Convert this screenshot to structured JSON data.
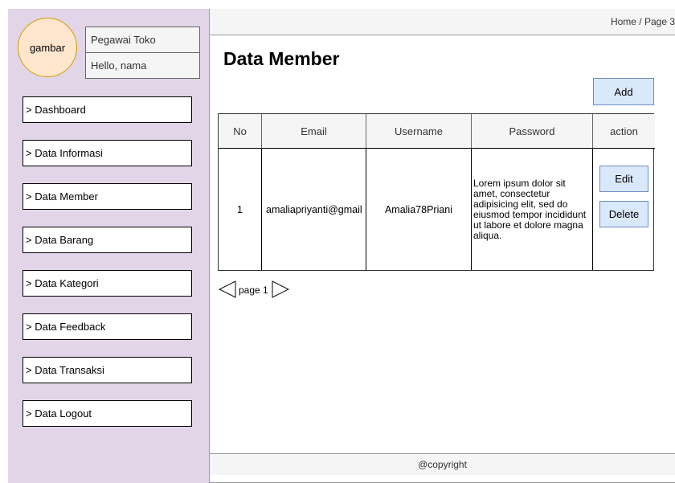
{
  "sidebar": {
    "avatar_text": "gambar",
    "role": "Pegawai Toko",
    "greeting": "Hello, nama",
    "items": [
      {
        "label": "> Dashboard"
      },
      {
        "label": "> Data Informasi"
      },
      {
        "label": "> Data Member"
      },
      {
        "label": "> Data Barang"
      },
      {
        "label": "> Data Kategori"
      },
      {
        "label": "> Data Feedback"
      },
      {
        "label": "> Data Transaksi"
      },
      {
        "label": "> Data Logout"
      }
    ]
  },
  "header": {
    "breadcrumb": "Home / Page 3"
  },
  "main": {
    "title": "Data Member",
    "add_label": "Add",
    "table": {
      "columns": [
        "No",
        "Email",
        "Username",
        "Password",
        "action"
      ],
      "rows": [
        {
          "no": "1",
          "email": "amaliapriyanti@gmail",
          "username": "Amalia78Priani",
          "password": "Lorem ipsum dolor sit amet, consectetur adipisicing elit, sed do eiusmod tempor incididunt ut labore et dolore magna aliqua.",
          "edit_label": "Edit",
          "delete_label": "Delete"
        }
      ]
    },
    "pagination": {
      "label": "page 1"
    }
  },
  "footer": {
    "text": "@copyright"
  },
  "colors": {
    "sidebar_bg": "#e1d5e7",
    "avatar_bg": "#ffe6cc",
    "avatar_border": "#d79b00",
    "button_bg": "#dae8fc",
    "button_border": "#6c8ebf"
  }
}
